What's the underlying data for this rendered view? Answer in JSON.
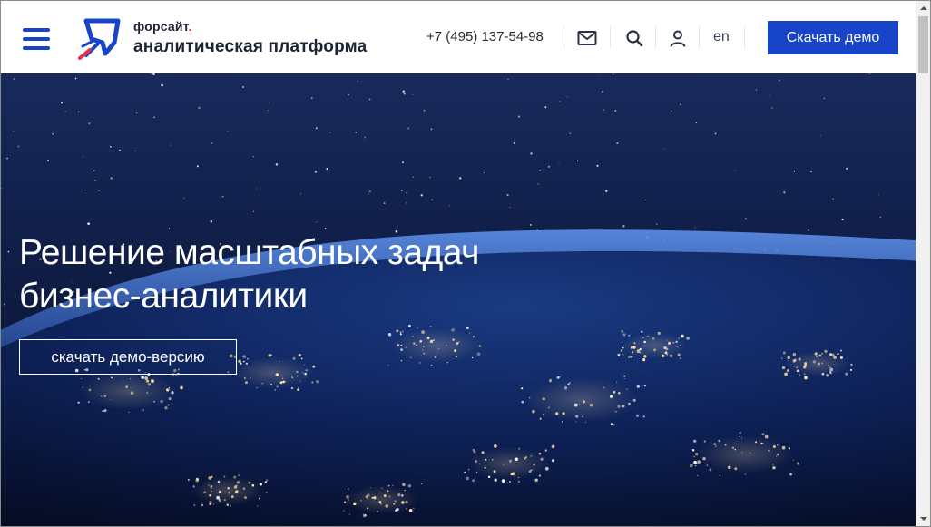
{
  "header": {
    "brand_small": "форсайт",
    "brand_dot": ".",
    "brand_big": "аналитическая платформа",
    "phone": "+7 (495) 137-54-98",
    "lang": "en",
    "cta_label": "Скачать демо"
  },
  "icons": {
    "menu": "hamburger-menu-icon",
    "logo": "rocket-logo-icon",
    "mail": "envelope-icon",
    "search": "search-icon",
    "user": "user-icon"
  },
  "hero": {
    "title_line1": "Решение масштабных задач",
    "title_line2": "бизнес-аналитики",
    "button_label": "скачать демо-версию"
  },
  "colors": {
    "accent": "#1744c8",
    "brand_dot": "#e6304a",
    "text_dark": "#1d2433"
  }
}
